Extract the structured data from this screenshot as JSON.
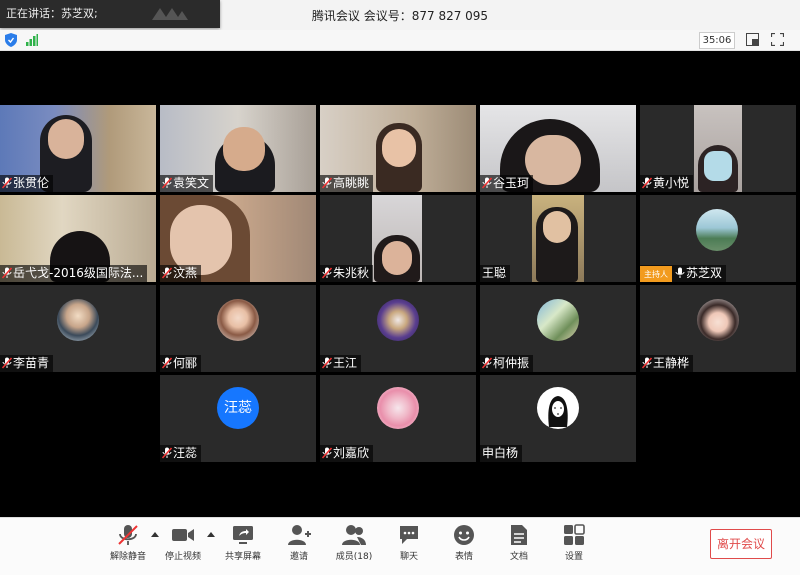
{
  "window": {
    "title": "腾讯会议 会议号：877 827 095"
  },
  "speaking": {
    "label": "正在讲话：苏芝双;"
  },
  "status": {
    "timer": "35:06"
  },
  "participants": [
    {
      "name": "张贯伦"
    },
    {
      "name": "袁笑文"
    },
    {
      "name": "高眺眺"
    },
    {
      "name": "谷玉珂"
    },
    {
      "name": "黄小悦"
    },
    {
      "name": "岳弋戈-2016级国际法..."
    },
    {
      "name": "汶燕"
    },
    {
      "name": "朱兆秋"
    },
    {
      "name": "王聪"
    },
    {
      "name": "苏芝双",
      "role": "主持人"
    },
    {
      "name": "李苗青"
    },
    {
      "name": "何郦"
    },
    {
      "name": "王江"
    },
    {
      "name": "柯仲振"
    },
    {
      "name": "王静桦"
    },
    {
      "name": "汪蕊",
      "avatar_text": "汪蕊"
    },
    {
      "name": "刘嘉欣"
    },
    {
      "name": "申白杨"
    }
  ],
  "toolbar": {
    "unmute": "解除静音",
    "stop_video": "停止视频",
    "share_screen": "共享屏幕",
    "invite": "邀请",
    "members": "成员(18)",
    "chat": "聊天",
    "emoji": "表情",
    "docs": "文档",
    "settings": "设置",
    "leave": "离开会议"
  },
  "colors": {
    "host_badge": "#f29b1e",
    "leave_red": "#e04b4b",
    "avatar_blue": "#1677ff"
  }
}
